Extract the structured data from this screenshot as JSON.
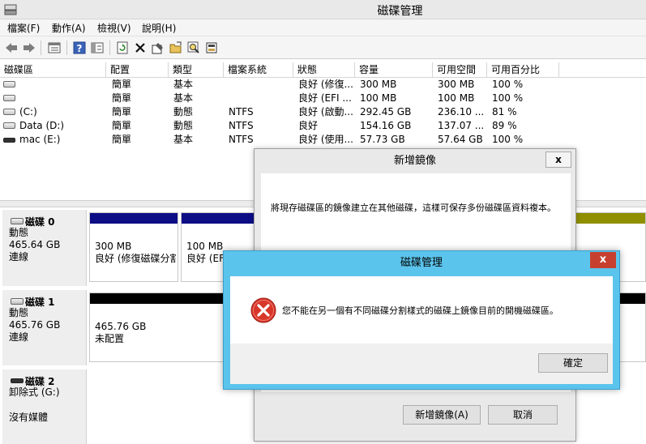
{
  "window": {
    "title": "磁碟管理"
  },
  "menu": [
    {
      "label": "檔案(F)"
    },
    {
      "label": "動作(A)"
    },
    {
      "label": "檢視(V)"
    },
    {
      "label": "說明(H)"
    }
  ],
  "toolbar": {
    "icons": [
      "back-icon",
      "forward-icon",
      "list-view-icon",
      "help-icon",
      "properties-view-icon",
      "refresh-icon",
      "delete-icon",
      "properties-icon",
      "open-icon",
      "search-icon",
      "export-icon"
    ]
  },
  "volume_list": {
    "columns": [
      "磁碟區",
      "配置",
      "類型",
      "檔案系統",
      "狀態",
      "容量",
      "可用空間",
      "可用百分比"
    ],
    "rows": [
      {
        "name": "",
        "layout": "簡單",
        "type": "基本",
        "fs": "",
        "status": "良好 (修復...",
        "capacity": "300 MB",
        "free": "300 MB",
        "pct": "100 %",
        "icon": "drive-icon"
      },
      {
        "name": "",
        "layout": "簡單",
        "type": "基本",
        "fs": "",
        "status": "良好 (EFI ...",
        "capacity": "100 MB",
        "free": "100 MB",
        "pct": "100 %",
        "icon": "drive-icon"
      },
      {
        "name": "(C:)",
        "layout": "簡單",
        "type": "動態",
        "fs": "NTFS",
        "status": "良好 (啟動...",
        "capacity": "292.45 GB",
        "free": "236.10 ...",
        "pct": "81 %",
        "icon": "drive-icon"
      },
      {
        "name": "Data (D:)",
        "layout": "簡單",
        "type": "動態",
        "fs": "NTFS",
        "status": "良好",
        "capacity": "154.16 GB",
        "free": "137.07 ...",
        "pct": "89 %",
        "icon": "drive-icon"
      },
      {
        "name": "mac (E:)",
        "layout": "簡單",
        "type": "基本",
        "fs": "NTFS",
        "status": "良好 (使用...",
        "capacity": "57.73 GB",
        "free": "57.64 GB",
        "pct": "100 %",
        "icon": "removable-drive-icon"
      }
    ]
  },
  "disks": [
    {
      "name": "磁碟 0",
      "type": "動態",
      "size": "465.64 GB",
      "state": "連線",
      "partitions": [
        {
          "size": "300 MB",
          "status": "良好 (修復磁碟分割)"
        },
        {
          "size": "100 MB",
          "status": "良好 (EFI"
        }
      ]
    },
    {
      "name": "磁碟 1",
      "type": "動態",
      "size": "465.76 GB",
      "state": "連線",
      "partitions": [
        {
          "size": "465.76 GB",
          "status": "未配置"
        }
      ]
    },
    {
      "name": "磁碟 2",
      "type": "卸除式 (G:)",
      "size": "",
      "state": "沒有媒體",
      "partitions": []
    }
  ],
  "mirror_dialog": {
    "title": "新增鏡像",
    "close": "x",
    "description": "將現存磁碟區的鏡像建立在其他磁碟，這樣可保存多份磁碟區資料複本。",
    "ok_label": "新增鏡像(A)",
    "cancel_label": "取消"
  },
  "error_dialog": {
    "title": "磁碟管理",
    "close": "x",
    "message": "您不能在另一個有不同磁碟分割樣式的磁碟上鏡像目前的開機磁碟區。",
    "ok_label": "確定"
  },
  "colors": {
    "partition_header_blue": "#0d0d86",
    "partition_header_black": "#000000",
    "partition_header_olive": "#8f8f00",
    "error_frame": "#5bc4ec",
    "close_red": "#c7402f"
  }
}
